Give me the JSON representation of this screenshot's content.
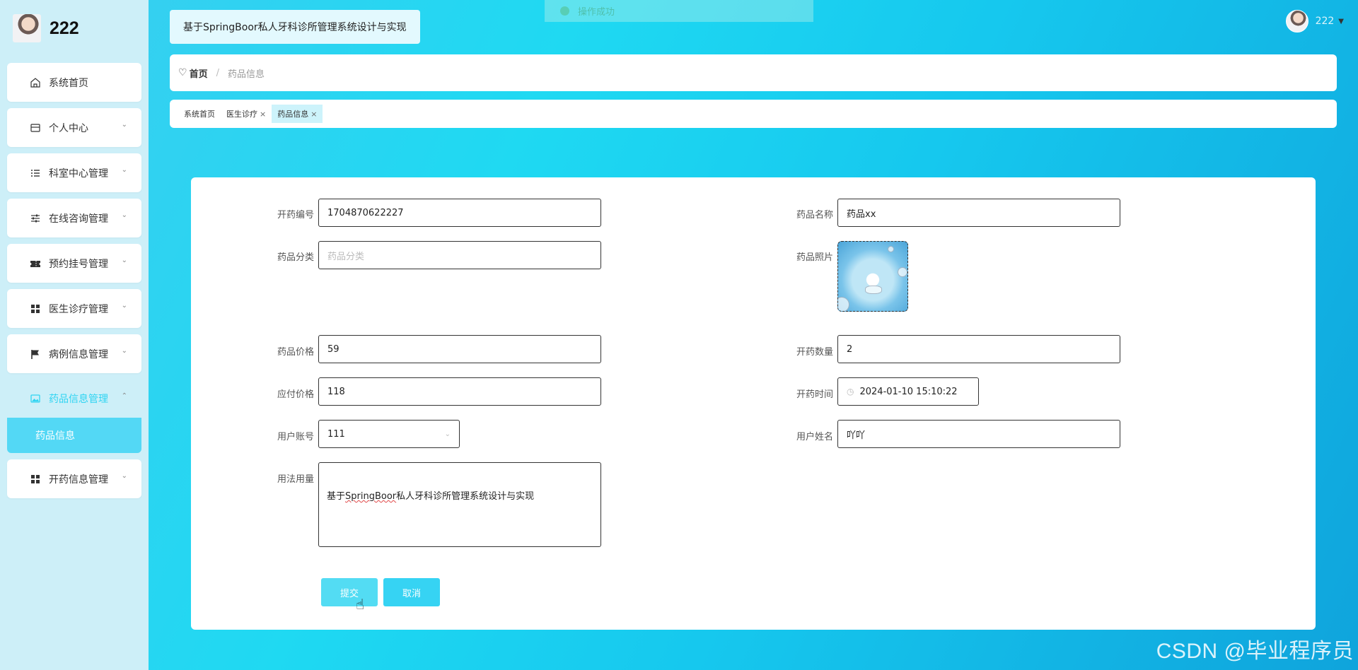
{
  "sidebar": {
    "brand_name": "222",
    "items": [
      {
        "label": "系统首页",
        "icon": "home-icon"
      },
      {
        "label": "个人中心",
        "icon": "card-icon"
      },
      {
        "label": "科室中心管理",
        "icon": "list-icon"
      },
      {
        "label": "在线咨询管理",
        "icon": "sliders-icon"
      },
      {
        "label": "预约挂号管理",
        "icon": "ticket-icon"
      },
      {
        "label": "医生诊疗管理",
        "icon": "grid-icon"
      },
      {
        "label": "病例信息管理",
        "icon": "flag-icon"
      },
      {
        "label": "药品信息管理",
        "icon": "image-icon"
      },
      {
        "label": "开药信息管理",
        "icon": "grid-icon"
      }
    ],
    "submenu_label": "药品信息"
  },
  "header": {
    "title": "基于SpringBoor私人牙科诊所管理系统设计与实现",
    "toast": "操作成功",
    "username": "222"
  },
  "breadcrumb": {
    "home": "首页",
    "separator": "/",
    "current": "药品信息"
  },
  "tabs": [
    {
      "label": "系统首页",
      "closable": false,
      "active": false
    },
    {
      "label": "医生诊疗",
      "closable": true,
      "active": false
    },
    {
      "label": "药品信息",
      "closable": true,
      "active": true
    }
  ],
  "form": {
    "prescription_no": {
      "label": "开药编号",
      "value": "1704870622227"
    },
    "drug_name": {
      "label": "药品名称",
      "value": "药品xx"
    },
    "drug_category": {
      "label": "药品分类",
      "placeholder": "药品分类"
    },
    "drug_photo": {
      "label": "药品照片"
    },
    "drug_price": {
      "label": "药品价格",
      "value": "59"
    },
    "quantity": {
      "label": "开药数量",
      "value": "2"
    },
    "payable": {
      "label": "应付价格",
      "value": "118"
    },
    "prescribe_time": {
      "label": "开药时间",
      "value": "2024-01-10 15:10:22"
    },
    "user_account": {
      "label": "用户账号",
      "value": "111"
    },
    "user_name": {
      "label": "用户姓名",
      "value": "吖吖"
    },
    "usage": {
      "label": "用法用量",
      "value_prefix": "基于",
      "value_underlined": "SpringBoor",
      "value_suffix": "私人牙科诊所管理系统设计与实现"
    },
    "submit_label": "提交",
    "cancel_label": "取消"
  },
  "watermark": "CSDN @毕业程序员",
  "colors": {
    "accent": "#36d3f3",
    "sidebar_bg": "#cdeff8",
    "active_text": "#2fd4f2"
  }
}
